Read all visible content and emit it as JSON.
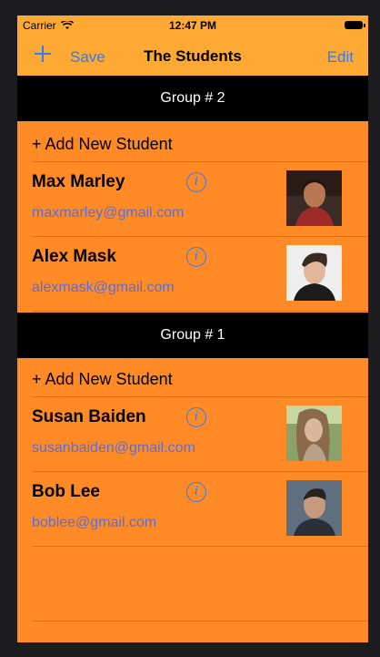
{
  "status": {
    "carrier": "Carrier",
    "time": "12:47 PM"
  },
  "navbar": {
    "add_icon": "plus-icon",
    "save_label": "Save",
    "title": "The Students",
    "edit_label": "Edit"
  },
  "sections": [
    {
      "header": "Group # 2",
      "add_label": "+ Add New Student",
      "students": [
        {
          "name": "Max Marley",
          "email": "maxmarley@gmail.com"
        },
        {
          "name": "Alex Mask",
          "email": "alexmask@gmail.com"
        }
      ]
    },
    {
      "header": "Group # 1",
      "add_label": "+ Add New Student",
      "students": [
        {
          "name": "Susan Baiden",
          "email": "susanbaiden@gmail.com"
        },
        {
          "name": "Bob Lee",
          "email": "boblee@gmail.com"
        }
      ]
    }
  ],
  "colors": {
    "accent": "#2f7cf6",
    "background": "#ff8a26",
    "navbar": "#ffa935",
    "header": "#000000"
  }
}
